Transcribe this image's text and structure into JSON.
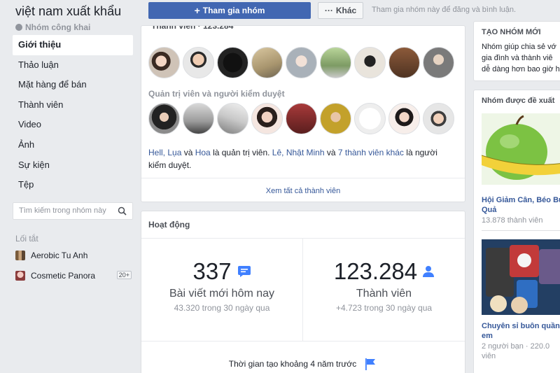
{
  "sidebar": {
    "group_name": "việt nam xuất khẩu",
    "privacy": "Nhóm công khai",
    "nav": [
      {
        "label": "Giới thiệu",
        "active": true
      },
      {
        "label": "Thảo luận",
        "active": false
      },
      {
        "label": "Mặt hàng để bán",
        "active": false
      },
      {
        "label": "Thành viên",
        "active": false
      },
      {
        "label": "Video",
        "active": false
      },
      {
        "label": "Ảnh",
        "active": false
      },
      {
        "label": "Sự kiện",
        "active": false
      },
      {
        "label": "Tệp",
        "active": false
      }
    ],
    "search_placeholder": "Tìm kiếm trong nhóm này",
    "shortcuts_title": "Lối tắt",
    "shortcuts": [
      {
        "label": "Aerobic Tu Anh",
        "badge": ""
      },
      {
        "label": "Cosmetic Panora",
        "badge": "20+"
      }
    ]
  },
  "actions": {
    "join_label": "Tham gia nhóm",
    "more_label": "Khác",
    "hint": "Tham gia nhóm này để đăng và bình luận."
  },
  "members": {
    "header_cut": "Thành viên · 123.284",
    "admins_title": "Quản trị viên và người kiểm duyệt",
    "admins_desc_parts": {
      "p1": "Hell, Lụa",
      "p2": " và ",
      "p3": "Hoa",
      "p4": " là quản trị viên. ",
      "p5": "Lê, Nhật Minh",
      "p6": " và ",
      "p7": "7 thành viên khác",
      "p8": " là người kiểm duyệt."
    },
    "see_all": "Xem tất cả thành viên"
  },
  "activity": {
    "title": "Hoạt động",
    "posts_today": "337",
    "posts_label": "Bài viết mới hôm nay",
    "posts_sub": "43.320 trong 30 ngày qua",
    "members_total": "123.284",
    "members_label": "Thành viên",
    "members_sub": "+4.723 trong 30 ngày qua",
    "created": "Thời gian tạo khoảng 4 năm trước"
  },
  "right": {
    "create_title": "TẠO NHÓM MỚI",
    "create_body": [
      "Nhóm giúp chia sẻ vớ",
      "gia đình và thành viê",
      "dễ dàng hơn bao giờ hế"
    ],
    "suggested_title": "Nhóm được đề xuất",
    "suggested": [
      {
        "name": "Hội Giảm Cân, Béo Bụng",
        "name2": "Quả",
        "sub": "13.878 thành viên"
      },
      {
        "name": "Chuyên sỉ buôn quần",
        "name2": "em",
        "sub": "2 người bạn · 220.0",
        "sub2": "viên"
      }
    ]
  },
  "colors": {
    "brand": "#4267b2",
    "link": "#365899",
    "bg": "#e9ebee"
  }
}
